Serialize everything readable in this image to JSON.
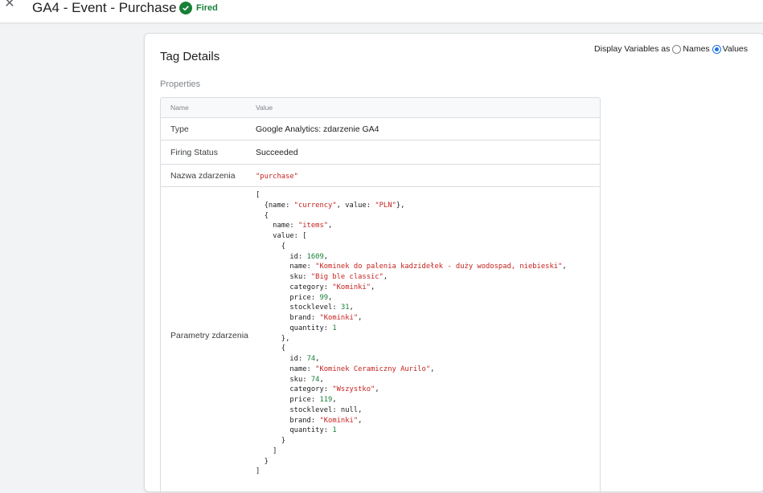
{
  "header": {
    "title": "GA4 - Event - Purchase",
    "status": "Fired",
    "close_icon": "close-icon",
    "status_icon": "check-circle-icon"
  },
  "panel": {
    "title": "Tag Details",
    "section": "Properties",
    "display_variables": {
      "label": "Display Variables as",
      "options": [
        "Names",
        "Values"
      ],
      "selected": "Values"
    }
  },
  "table": {
    "columns": [
      "Name",
      "Value"
    ],
    "rows": [
      {
        "name": "Type",
        "value": "Google Analytics: zdarzenie GA4"
      },
      {
        "name": "Firing Status",
        "value": "Succeeded"
      },
      {
        "name": "Nazwa zdarzenia",
        "value": "\"purchase\""
      },
      {
        "name": "Parametry zdarzenia",
        "value_lines": [
          [
            {
              "t": "["
            }
          ],
          [
            {
              "t": "  {name: "
            },
            {
              "t": "\"currency\"",
              "c": "str"
            },
            {
              "t": ", value: "
            },
            {
              "t": "\"PLN\"",
              "c": "str"
            },
            {
              "t": "},"
            }
          ],
          [
            {
              "t": "  {"
            }
          ],
          [
            {
              "t": "    name: "
            },
            {
              "t": "\"items\"",
              "c": "str"
            },
            {
              "t": ","
            }
          ],
          [
            {
              "t": "    value: ["
            }
          ],
          [
            {
              "t": "      {"
            }
          ],
          [
            {
              "t": "        id: "
            },
            {
              "t": "1609",
              "c": "num"
            },
            {
              "t": ","
            }
          ],
          [
            {
              "t": "        name: "
            },
            {
              "t": "\"Kominek do palenia kadzidełek - duży wodospad, niebieski\"",
              "c": "str"
            },
            {
              "t": ","
            }
          ],
          [
            {
              "t": "        sku: "
            },
            {
              "t": "\"Big ble classic\"",
              "c": "str"
            },
            {
              "t": ","
            }
          ],
          [
            {
              "t": "        category: "
            },
            {
              "t": "\"Kominki\"",
              "c": "str"
            },
            {
              "t": ","
            }
          ],
          [
            {
              "t": "        price: "
            },
            {
              "t": "99",
              "c": "num"
            },
            {
              "t": ","
            }
          ],
          [
            {
              "t": "        stocklevel: "
            },
            {
              "t": "31",
              "c": "num"
            },
            {
              "t": ","
            }
          ],
          [
            {
              "t": "        brand: "
            },
            {
              "t": "\"Kominki\"",
              "c": "str"
            },
            {
              "t": ","
            }
          ],
          [
            {
              "t": "        quantity: "
            },
            {
              "t": "1",
              "c": "num"
            }
          ],
          [
            {
              "t": "      },"
            }
          ],
          [
            {
              "t": "      {"
            }
          ],
          [
            {
              "t": "        id: "
            },
            {
              "t": "74",
              "c": "num"
            },
            {
              "t": ","
            }
          ],
          [
            {
              "t": "        name: "
            },
            {
              "t": "\"Kominek Ceramiczny Aurilo\"",
              "c": "str"
            },
            {
              "t": ","
            }
          ],
          [
            {
              "t": "        sku: "
            },
            {
              "t": "74",
              "c": "num"
            },
            {
              "t": ","
            }
          ],
          [
            {
              "t": "        category: "
            },
            {
              "t": "\"Wszystko\"",
              "c": "str"
            },
            {
              "t": ","
            }
          ],
          [
            {
              "t": "        price: "
            },
            {
              "t": "119",
              "c": "num"
            },
            {
              "t": ","
            }
          ],
          [
            {
              "t": "        stocklevel: null,"
            }
          ],
          [
            {
              "t": "        brand: "
            },
            {
              "t": "\"Kominki\"",
              "c": "str"
            },
            {
              "t": ","
            }
          ],
          [
            {
              "t": "        quantity: "
            },
            {
              "t": "1",
              "c": "num"
            }
          ],
          [
            {
              "t": "      }"
            }
          ],
          [
            {
              "t": "    ]"
            }
          ],
          [
            {
              "t": "  }"
            }
          ],
          [
            {
              "t": "]"
            }
          ]
        ]
      }
    ]
  },
  "colors": {
    "accent": "#1a73e8",
    "fired": "#188038",
    "string": "#c5221f",
    "number": "#188038"
  }
}
